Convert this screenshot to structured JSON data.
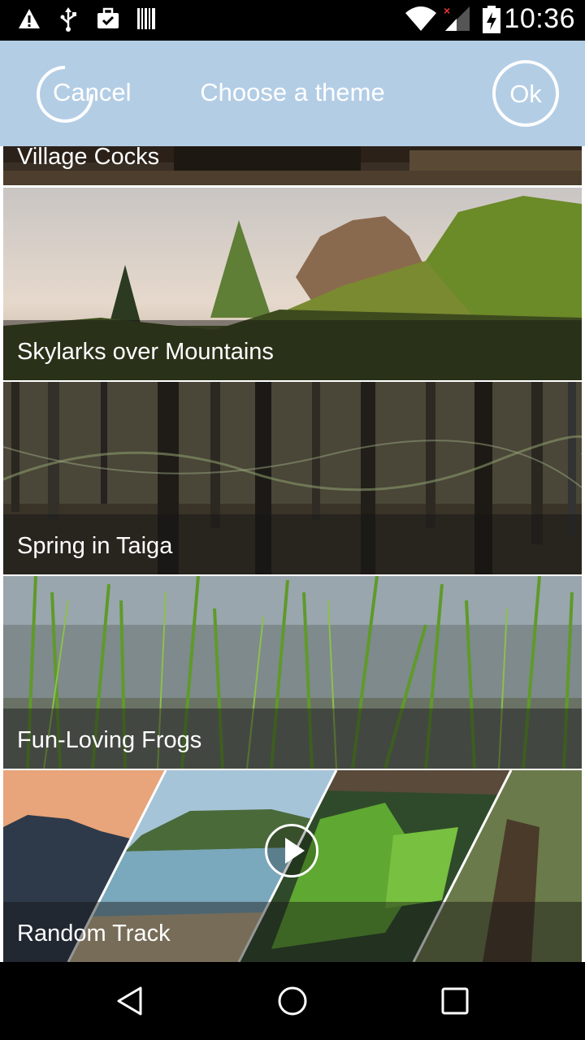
{
  "status_bar": {
    "time": "10:36",
    "icons": [
      "warning-icon",
      "usb-icon",
      "briefcase-check-icon",
      "barcode-icon",
      "wifi-icon",
      "signal-icon",
      "battery-icon"
    ]
  },
  "header": {
    "title": "Choose a theme",
    "cancel_label": "Cancel",
    "ok_label": "Ok",
    "background": "#b3cde5"
  },
  "themes": [
    {
      "name": "Village Cocks"
    },
    {
      "name": "Skylarks over Mountains"
    },
    {
      "name": "Spring in Taiga"
    },
    {
      "name": "Fun-Loving Frogs"
    },
    {
      "name": "Random Track"
    }
  ],
  "nav_bar": {
    "icons": [
      "back-icon",
      "home-icon",
      "recents-icon"
    ]
  }
}
